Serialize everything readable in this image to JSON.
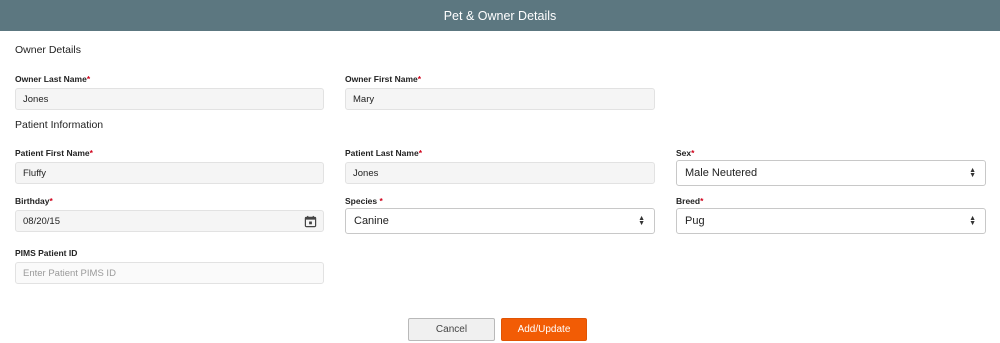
{
  "header": {
    "title": "Pet & Owner Details"
  },
  "owner": {
    "section_title": "Owner Details",
    "last_name": {
      "label": "Owner Last Name",
      "required": "*",
      "value": "Jones"
    },
    "first_name": {
      "label": "Owner First Name",
      "required": "*",
      "value": "Mary"
    }
  },
  "patient": {
    "section_title": "Patient Information",
    "first_name": {
      "label": "Patient First Name",
      "required": "*",
      "value": "Fluffy"
    },
    "last_name": {
      "label": "Patient Last Name",
      "required": "*",
      "value": "Jones"
    },
    "sex": {
      "label": "Sex",
      "required": "*",
      "value": "Male Neutered"
    },
    "birthday": {
      "label": "Birthday",
      "required": "*",
      "value": "08/20/15",
      "icon": "calendar-icon"
    },
    "species": {
      "label": "Species ",
      "required": "*",
      "value": "Canine"
    },
    "breed": {
      "label": "Breed",
      "required": "*",
      "value": "Pug"
    },
    "pims_id": {
      "label": "PIMS Patient ID",
      "placeholder": "Enter Patient PIMS ID"
    }
  },
  "actions": {
    "cancel_label": "Cancel",
    "submit_label": "Add/Update"
  },
  "colors": {
    "header_bg": "#5c7780",
    "accent": "#f25c05",
    "required": "#d0021b"
  }
}
